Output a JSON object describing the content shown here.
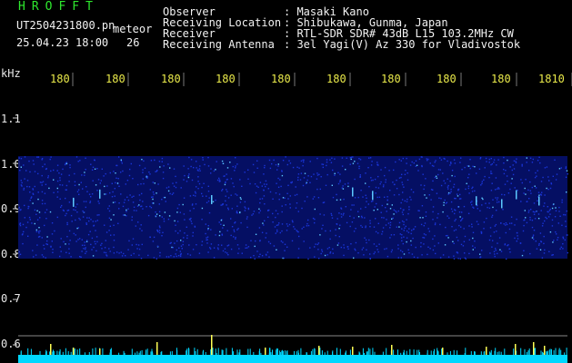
{
  "header": {
    "title": "HROFFT",
    "filename": "UT2504231800.pn",
    "mode_label": "meteor",
    "datetime": "25.04.23 18:00",
    "count": "26",
    "fields": [
      {
        "label": "Observer",
        "value": ": Masaki Kano"
      },
      {
        "label": "Receiving Location",
        "value": ": Shibukawa, Gunma, Japan"
      },
      {
        "label": "Receiver",
        "value": ": RTL-SDR SDR# 43dB L15 103.2MHz CW"
      },
      {
        "label": "Receiving Antenna",
        "value": ": 3el Yagi(V) Az 330 for Vladivostok"
      }
    ]
  },
  "plot": {
    "unit_label": "kHz",
    "time_labels": [
      "180",
      "180",
      "180",
      "180",
      "180",
      "180",
      "180",
      "180",
      "180",
      "1810"
    ],
    "freq_labels": [
      "1.1",
      "1.0",
      "0.9",
      "0.8",
      "0.7",
      "0.6"
    ],
    "colors": {
      "band_background": "#06116e",
      "speckle_dim": "#1a35d8",
      "speckle_bright": "#5cc8ff",
      "baseline": "#00d8ff",
      "meteor_spike": "#ffff55",
      "axis_tick": "#cccccc"
    }
  }
}
